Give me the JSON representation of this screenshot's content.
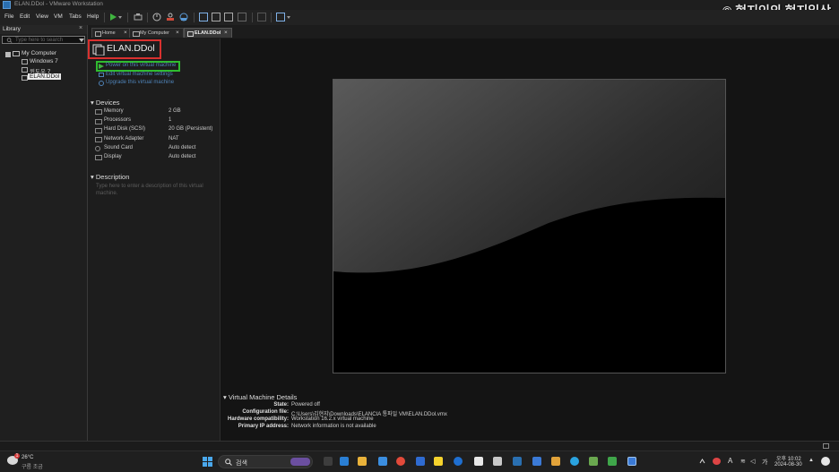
{
  "window": {
    "title": "ELAN.DDol - VMware Workstation",
    "watermark": "© 현지인의 현지일상"
  },
  "menu": [
    "File",
    "Edit",
    "View",
    "VM",
    "Tabs",
    "Help"
  ],
  "library": {
    "title": "Library",
    "close": "×",
    "search_placeholder": "Type here to search",
    "root": "My Computer",
    "items": [
      "Windows 7",
      "윈도우 7",
      "ELAN.DDol"
    ]
  },
  "tabs": [
    {
      "label": "Home"
    },
    {
      "label": "My Computer"
    },
    {
      "label": "ELAN.DDol"
    }
  ],
  "summary": {
    "vm_name": "ELAN.DDol",
    "actions": {
      "power": "Power on this virtual machine",
      "edit": "Edit virtual machine settings",
      "upgrade": "Upgrade this virtual machine"
    },
    "devices_heading": "Devices",
    "devices": [
      {
        "name": "Memory",
        "value": "2 GB"
      },
      {
        "name": "Processors",
        "value": "1"
      },
      {
        "name": "Hard Disk (SCSI)",
        "value": "20 GB (Persistent)"
      },
      {
        "name": "Network Adapter",
        "value": "NAT"
      },
      {
        "name": "Sound Card",
        "value": "Auto detect"
      },
      {
        "name": "Display",
        "value": "Auto detect"
      }
    ],
    "description_heading": "Description",
    "description_placeholder": "Type here to enter a description of this virtual machine."
  },
  "details": {
    "heading": "Virtual Machine Details",
    "rows": [
      {
        "key": "State:",
        "value": "Powered off"
      },
      {
        "key": "Configuration file:",
        "value": "C:\\Users\\김현지\\Downloads\\ELANCIA 통파일 VM\\ELAN.DDol.vmx"
      },
      {
        "key": "Hardware compatibility:",
        "value": "Workstation 16.2.x virtual machine"
      },
      {
        "key": "Primary IP address:",
        "value": "Network information is not available"
      }
    ]
  },
  "taskbar": {
    "weather_temp": "26°C",
    "weather_desc": "구름 조금",
    "weather_badge": "1",
    "search_label": "검색",
    "ime": "A",
    "ime_lang": "가",
    "time": "오후 10:02",
    "date": "2024-08-30"
  }
}
